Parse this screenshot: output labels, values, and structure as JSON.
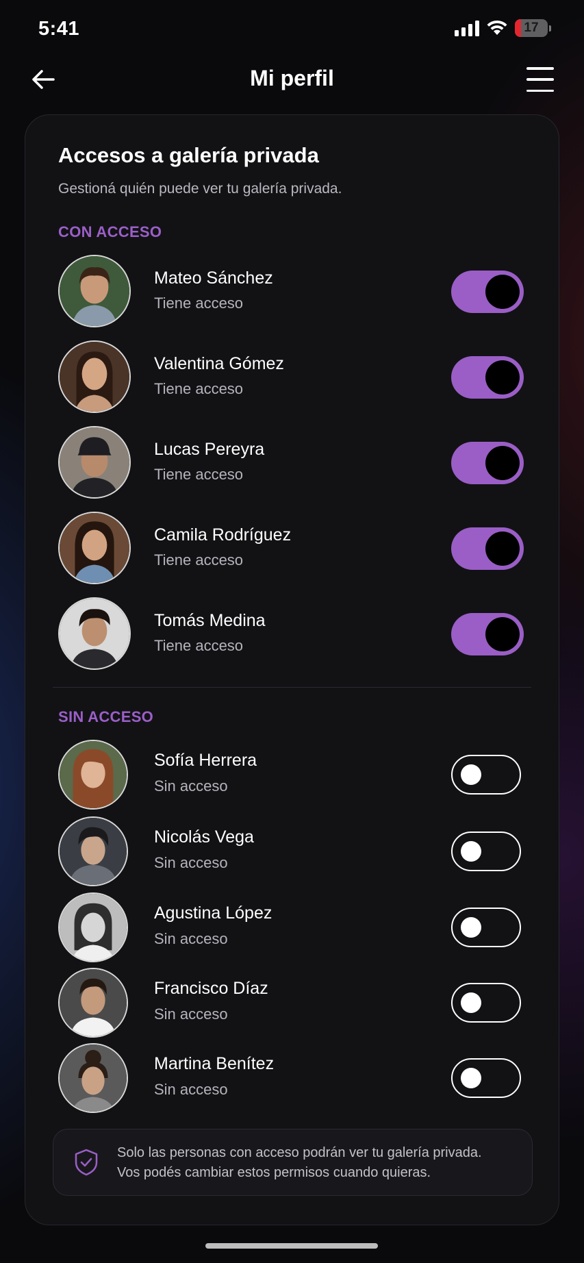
{
  "status_bar": {
    "time": "5:41",
    "battery": "17"
  },
  "header": {
    "title": "Mi perfil"
  },
  "card": {
    "title": "Accesos a galería privada",
    "subtitle": "Gestioná quién puede ver tu galería privada.",
    "with_access_label": "CON ACCESO",
    "without_access_label": "SIN ACCESO",
    "with_access": [
      {
        "name": "Mateo Sánchez",
        "status": "Tiene acceso",
        "enabled": true
      },
      {
        "name": "Valentina Gómez",
        "status": "Tiene acceso",
        "enabled": true
      },
      {
        "name": "Lucas Pereyra",
        "status": "Tiene acceso",
        "enabled": true
      },
      {
        "name": "Camila Rodríguez",
        "status": "Tiene acceso",
        "enabled": true
      },
      {
        "name": "Tomás Medina",
        "status": "Tiene acceso",
        "enabled": true
      }
    ],
    "without_access": [
      {
        "name": "Sofía Herrera",
        "status": "Sin acceso",
        "enabled": false
      },
      {
        "name": "Nicolás Vega",
        "status": "Sin acceso",
        "enabled": false
      },
      {
        "name": "Agustina López",
        "status": "Sin acceso",
        "enabled": false
      },
      {
        "name": "Francisco Díaz",
        "status": "Sin acceso",
        "enabled": false
      },
      {
        "name": "Martina Benítez",
        "status": "Sin acceso",
        "enabled": false
      }
    ],
    "info": {
      "line1": "Solo las personas con acceso podrán ver tu galería privada.",
      "line2": "Vos podés cambiar estos permisos cuando quieras.",
      "icon": "shield-check-icon"
    }
  },
  "colors": {
    "accent": "#9a5ec6",
    "section_label": "#9b5fc8",
    "background": "#0a0a0d",
    "card": "#121215"
  }
}
